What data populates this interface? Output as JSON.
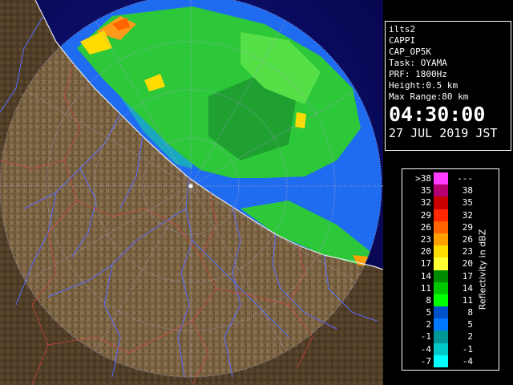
{
  "info_panel": {
    "site": "ilts2",
    "product": "CAPPI",
    "product_name": "CAP_OP5K",
    "task": "Task: OYAMA",
    "prf": "PRF: 1800Hz",
    "height": "Height:0.5 km",
    "max_range": "Max Range:80 km",
    "time": "04:30:00",
    "date": "27 JUL 2019 JST"
  },
  "legend": {
    "title": "Reflectivity in dBZ",
    "rows": [
      {
        "low": ">38",
        "high": "---",
        "color": "#ff3cff"
      },
      {
        "low": "35",
        "high": "38",
        "color": "#b4006e"
      },
      {
        "low": "32",
        "high": "35",
        "color": "#c80000"
      },
      {
        "low": "29",
        "high": "32",
        "color": "#ff2800"
      },
      {
        "low": "26",
        "high": "29",
        "color": "#ff6400"
      },
      {
        "low": "23",
        "high": "26",
        "color": "#ffa000"
      },
      {
        "low": "20",
        "high": "23",
        "color": "#ffdc00"
      },
      {
        "low": "17",
        "high": "20",
        "color": "#ffff32"
      },
      {
        "low": "14",
        "high": "17",
        "color": "#008c00"
      },
      {
        "low": "11",
        "high": "14",
        "color": "#00c800"
      },
      {
        "low": "8",
        "high": "11",
        "color": "#00ff00"
      },
      {
        "low": "5",
        "high": "8",
        "color": "#0050c8"
      },
      {
        "low": "2",
        "high": "5",
        "color": "#0078ff"
      },
      {
        "low": "-1",
        "high": "2",
        "color": "#009696"
      },
      {
        "low": "-4",
        "high": "-1",
        "color": "#00c8c8"
      },
      {
        "low": "-7",
        "high": "-4",
        "color": "#00ffff"
      }
    ]
  },
  "colors": {
    "sea": "#0a0a6e",
    "land": "#7a6040",
    "echo_weak": "#1f6cf0",
    "echo_mid": "#2dc83a",
    "echo_strong": "#ff9a1a",
    "range_ring": "#a0a0c8",
    "river": "#5a6cff",
    "border": "#e04040"
  },
  "map": {
    "icons": [
      "radar-range-rings",
      "radar-radials",
      "coastline",
      "rivers",
      "admin-borders",
      "radar-site-marker"
    ]
  }
}
